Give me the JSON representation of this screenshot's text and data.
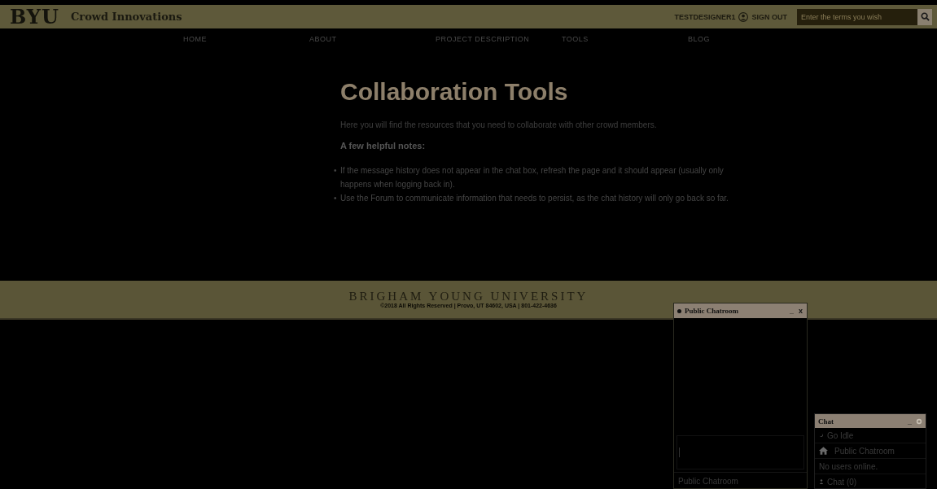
{
  "header": {
    "logo": "BYU",
    "site_name": "Crowd Innovations",
    "user": "TESTDESIGNER1",
    "sign_out": "SIGN OUT",
    "search": {
      "placeholder": "Enter the terms you wish"
    }
  },
  "nav": [
    {
      "label": "HOME"
    },
    {
      "label": "ABOUT"
    },
    {
      "label": "PROJECT DESCRIPTION"
    },
    {
      "label": "TOOLS"
    },
    {
      "label": "BLOG"
    }
  ],
  "content": {
    "title": "Collaboration Tools",
    "intro": "Here you will find the resources that you need to collaborate with other crowd members.",
    "notes_heading": "A few helpful notes:",
    "notes": [
      {
        "marker": "•",
        "text": "If the message history does not appear in the chat box, refresh the page and it should appear (usually only happens when logging back in)."
      },
      {
        "marker": "•",
        "text": "Use the Forum to communicate information that needs to persist, as the chat history will only go back so far."
      }
    ]
  },
  "footer": {
    "university": "BRIGHAM YOUNG UNIVERSITY",
    "copyright": "©2018 All Rights Reserved | Provo, UT 84602, USA | 801-422-4636"
  },
  "chatroom": {
    "title": "Public Chatroom",
    "minimize": "_",
    "close": "x",
    "footer": "Public Chatroom"
  },
  "chat_panel": {
    "title": "Chat",
    "minimize": "_",
    "status": "Go Idle",
    "room": "Public Chatroom",
    "users": "No users online.",
    "tab": "Chat (0)"
  }
}
